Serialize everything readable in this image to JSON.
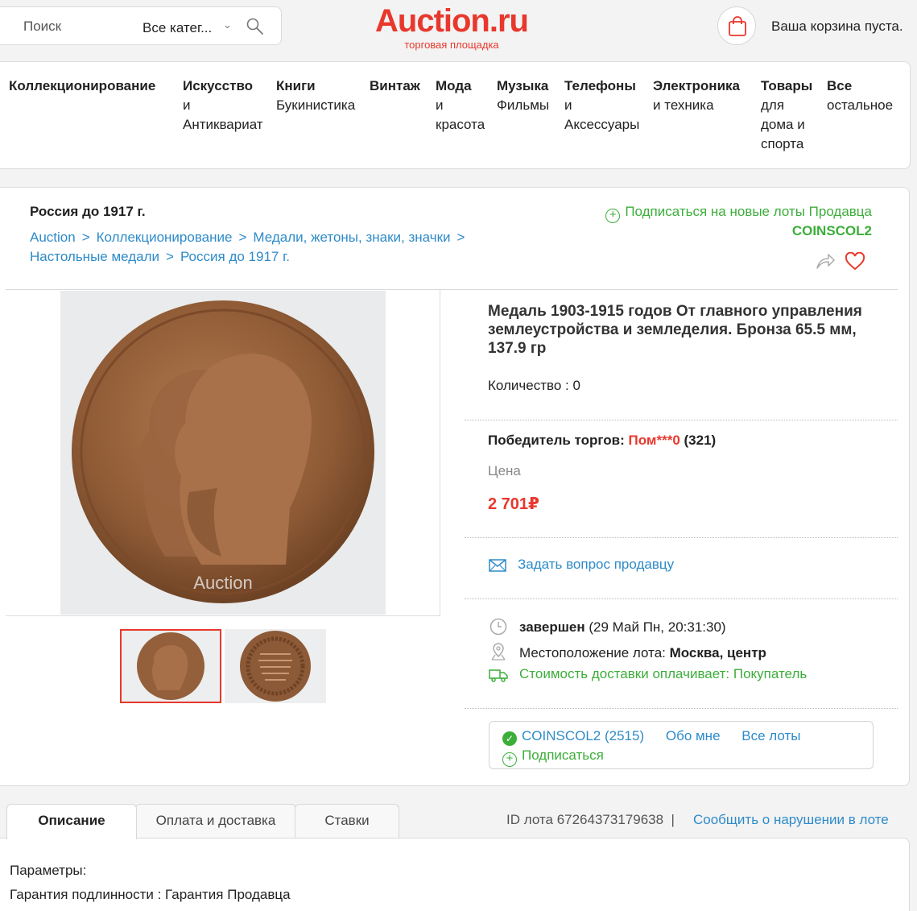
{
  "header": {
    "search_placeholder": "Поиск",
    "category_select": "Все катег...",
    "logo_text": "Auction.ru",
    "logo_subtitle": "торговая площадка",
    "cart_text": "Ваша корзина пуста."
  },
  "nav": [
    {
      "title": "Коллекционирование",
      "sub": []
    },
    {
      "title": "Искусство",
      "sub": [
        "и",
        "Антиквариат"
      ]
    },
    {
      "title": "Книги",
      "sub": [
        "Букинистика"
      ]
    },
    {
      "title": "Винтаж",
      "sub": []
    },
    {
      "title": "Мода",
      "sub": [
        "и",
        "красота"
      ]
    },
    {
      "title": "Музыка",
      "sub": [
        "Фильмы"
      ]
    },
    {
      "title": "Телефоны",
      "sub": [
        "и",
        "Аксессуары"
      ]
    },
    {
      "title": "Электроника",
      "sub": [
        "и техника"
      ]
    },
    {
      "title": "Товары",
      "sub": [
        "для",
        "дома и",
        "спорта"
      ]
    },
    {
      "title": "Все",
      "sub": [
        "остальное"
      ]
    }
  ],
  "lot": {
    "category_title": "Россия до 1917 г.",
    "breadcrumb": [
      "Auction",
      "Коллекционирование",
      "Медали, жетоны, знаки, значки",
      "Настольные медали",
      "Россия до 1917 г."
    ],
    "breadcrumb_sep": ">",
    "subscribe_seller": "Подписаться на новые лоты Продавца",
    "seller_name": "COINSCOL2",
    "title": "Медаль 1903-1915 годов От главного управления землеустройства и земледелия. Бронза 65.5 мм, 137.9 гр",
    "quantity": "Количество : 0",
    "winner_label": "Победитель торгов:",
    "winner_name": "Пом***0",
    "winner_rating": "(321)",
    "price_label": "Цена",
    "price": "2 701₽",
    "ask_seller": "Задать вопрос продавцу",
    "status": "завершен",
    "status_date": "(29 Май Пн, 20:31:30)",
    "location_label": "Местоположение лота:",
    "location": "Москва, центр",
    "delivery": "Стоимость доставки оплачивает: Покупатель",
    "seller_box": {
      "seller": "COINSCOL2 (2515)",
      "about": "Обо мне",
      "all_lots": "Все лоты",
      "subscribe": "Подписаться"
    },
    "watermark": "Auction"
  },
  "tabs": [
    "Описание",
    "Оплата и доставка",
    "Ставки"
  ],
  "lot_id": "ID лота 67264373179638",
  "lot_id_sep": "|",
  "report": "Сообщить о нарушении в лоте",
  "params": {
    "label": "Параметры:",
    "authenticity": "Гарантия подлинности : Гарантия Продавца"
  },
  "colors": {
    "brand": "#e8382d",
    "link": "#2e8bc9",
    "green": "#3cae3a"
  },
  "icons": [
    "search-icon",
    "chevron-down-icon",
    "shopping-bag-icon",
    "plus-circle-icon",
    "share-icon",
    "heart-icon",
    "envelope-icon",
    "clock-icon",
    "location-pin-icon",
    "truck-icon",
    "check-circle-icon"
  ]
}
